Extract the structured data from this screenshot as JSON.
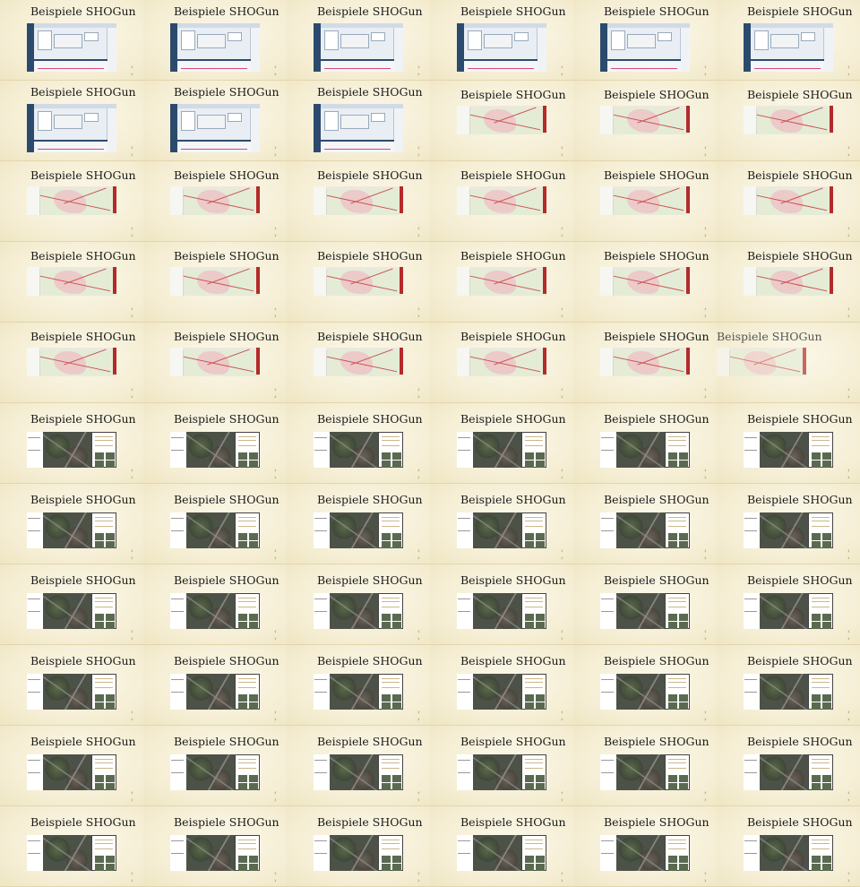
{
  "grid": {
    "title": "Beispiele SHOGun",
    "nav_label": "‹ ›",
    "items": [
      {
        "title": "Beispiele SHOGun",
        "kind": "admin-screenshot",
        "faded": false
      },
      {
        "title": "Beispiele SHOGun",
        "kind": "admin-screenshot",
        "faded": false
      },
      {
        "title": "Beispiele SHOGun",
        "kind": "admin-screenshot",
        "faded": false
      },
      {
        "title": "Beispiele SHOGun",
        "kind": "admin-screenshot",
        "faded": false
      },
      {
        "title": "Beispiele SHOGun",
        "kind": "admin-screenshot",
        "faded": false
      },
      {
        "title": "Beispiele SHOGun",
        "kind": "admin-screenshot",
        "faded": false
      },
      {
        "title": "Beispiele SHOGun",
        "kind": "admin-screenshot",
        "faded": false
      },
      {
        "title": "Beispiele SHOGun",
        "kind": "admin-screenshot",
        "faded": false
      },
      {
        "title": "Beispiele SHOGun",
        "kind": "admin-screenshot",
        "faded": false
      },
      {
        "title": "Beispiele SHOGun",
        "kind": "map-screenshot",
        "faded": false
      },
      {
        "title": "Beispiele SHOGun",
        "kind": "map-screenshot",
        "faded": false
      },
      {
        "title": "Beispiele SHOGun",
        "kind": "map-screenshot",
        "faded": false
      },
      {
        "title": "Beispiele SHOGun",
        "kind": "map-screenshot",
        "faded": false
      },
      {
        "title": "Beispiele SHOGun",
        "kind": "map-screenshot",
        "faded": false
      },
      {
        "title": "Beispiele SHOGun",
        "kind": "map-screenshot",
        "faded": false
      },
      {
        "title": "Beispiele SHOGun",
        "kind": "map-screenshot",
        "faded": false
      },
      {
        "title": "Beispiele SHOGun",
        "kind": "map-screenshot",
        "faded": false
      },
      {
        "title": "Beispiele SHOGun",
        "kind": "map-screenshot",
        "faded": false
      },
      {
        "title": "Beispiele SHOGun",
        "kind": "map-screenshot",
        "faded": false
      },
      {
        "title": "Beispiele SHOGun",
        "kind": "map-screenshot",
        "faded": false
      },
      {
        "title": "Beispiele SHOGun",
        "kind": "map-screenshot",
        "faded": false
      },
      {
        "title": "Beispiele SHOGun",
        "kind": "map-screenshot",
        "faded": false
      },
      {
        "title": "Beispiele SHOGun",
        "kind": "map-screenshot",
        "faded": false
      },
      {
        "title": "Beispiele SHOGun",
        "kind": "map-screenshot",
        "faded": false
      },
      {
        "title": "Beispiele SHOGun",
        "kind": "map-screenshot",
        "faded": false
      },
      {
        "title": "Beispiele SHOGun",
        "kind": "map-screenshot",
        "faded": false
      },
      {
        "title": "Beispiele SHOGun",
        "kind": "map-screenshot",
        "faded": false
      },
      {
        "title": "Beispiele SHOGun",
        "kind": "map-screenshot",
        "faded": false
      },
      {
        "title": "Beispiele SHOGun",
        "kind": "map-screenshot",
        "faded": false
      },
      {
        "title": "Beispiele SHOGun",
        "kind": "map-screenshot",
        "faded": true
      },
      {
        "title": "Beispiele SHOGun",
        "kind": "aerial-screenshot",
        "faded": false
      },
      {
        "title": "Beispiele SHOGun",
        "kind": "aerial-screenshot",
        "faded": false
      },
      {
        "title": "Beispiele SHOGun",
        "kind": "aerial-screenshot",
        "faded": false
      },
      {
        "title": "Beispiele SHOGun",
        "kind": "aerial-screenshot",
        "faded": false
      },
      {
        "title": "Beispiele SHOGun",
        "kind": "aerial-screenshot",
        "faded": false
      },
      {
        "title": "Beispiele SHOGun",
        "kind": "aerial-screenshot",
        "faded": false
      },
      {
        "title": "Beispiele SHOGun",
        "kind": "aerial-screenshot",
        "faded": false
      },
      {
        "title": "Beispiele SHOGun",
        "kind": "aerial-screenshot",
        "faded": false
      },
      {
        "title": "Beispiele SHOGun",
        "kind": "aerial-screenshot",
        "faded": false
      },
      {
        "title": "Beispiele SHOGun",
        "kind": "aerial-screenshot",
        "faded": false
      },
      {
        "title": "Beispiele SHOGun",
        "kind": "aerial-screenshot",
        "faded": false
      },
      {
        "title": "Beispiele SHOGun",
        "kind": "aerial-screenshot",
        "faded": false
      },
      {
        "title": "Beispiele SHOGun",
        "kind": "aerial-screenshot",
        "faded": false
      },
      {
        "title": "Beispiele SHOGun",
        "kind": "aerial-screenshot",
        "faded": false
      },
      {
        "title": "Beispiele SHOGun",
        "kind": "aerial-screenshot",
        "faded": false
      },
      {
        "title": "Beispiele SHOGun",
        "kind": "aerial-screenshot",
        "faded": false
      },
      {
        "title": "Beispiele SHOGun",
        "kind": "aerial-screenshot",
        "faded": false
      },
      {
        "title": "Beispiele SHOGun",
        "kind": "aerial-screenshot",
        "faded": false
      },
      {
        "title": "Beispiele SHOGun",
        "kind": "aerial-screenshot",
        "faded": false
      },
      {
        "title": "Beispiele SHOGun",
        "kind": "aerial-screenshot",
        "faded": false
      },
      {
        "title": "Beispiele SHOGun",
        "kind": "aerial-screenshot",
        "faded": false
      },
      {
        "title": "Beispiele SHOGun",
        "kind": "aerial-screenshot",
        "faded": false
      },
      {
        "title": "Beispiele SHOGun",
        "kind": "aerial-screenshot",
        "faded": false
      },
      {
        "title": "Beispiele SHOGun",
        "kind": "aerial-screenshot",
        "faded": false
      },
      {
        "title": "Beispiele SHOGun",
        "kind": "aerial-screenshot",
        "faded": false
      },
      {
        "title": "Beispiele SHOGun",
        "kind": "aerial-screenshot",
        "faded": false
      },
      {
        "title": "Beispiele SHOGun",
        "kind": "aerial-screenshot",
        "faded": false
      },
      {
        "title": "Beispiele SHOGun",
        "kind": "aerial-screenshot",
        "faded": false
      },
      {
        "title": "Beispiele SHOGun",
        "kind": "aerial-screenshot",
        "faded": false
      },
      {
        "title": "Beispiele SHOGun",
        "kind": "aerial-screenshot",
        "faded": false
      },
      {
        "title": "Beispiele SHOGun",
        "kind": "aerial-screenshot",
        "faded": false
      },
      {
        "title": "Beispiele SHOGun",
        "kind": "aerial-screenshot",
        "faded": false
      },
      {
        "title": "Beispiele SHOGun",
        "kind": "aerial-screenshot",
        "faded": false
      },
      {
        "title": "Beispiele SHOGun",
        "kind": "aerial-screenshot",
        "faded": false
      },
      {
        "title": "Beispiele SHOGun",
        "kind": "aerial-screenshot",
        "faded": false
      },
      {
        "title": "Beispiele SHOGun",
        "kind": "aerial-screenshot",
        "faded": false
      }
    ]
  },
  "colors": {
    "background": "#f6f0d8",
    "admin_sidebar": "#2c4a6e",
    "map_accent": "#b52a2a"
  }
}
